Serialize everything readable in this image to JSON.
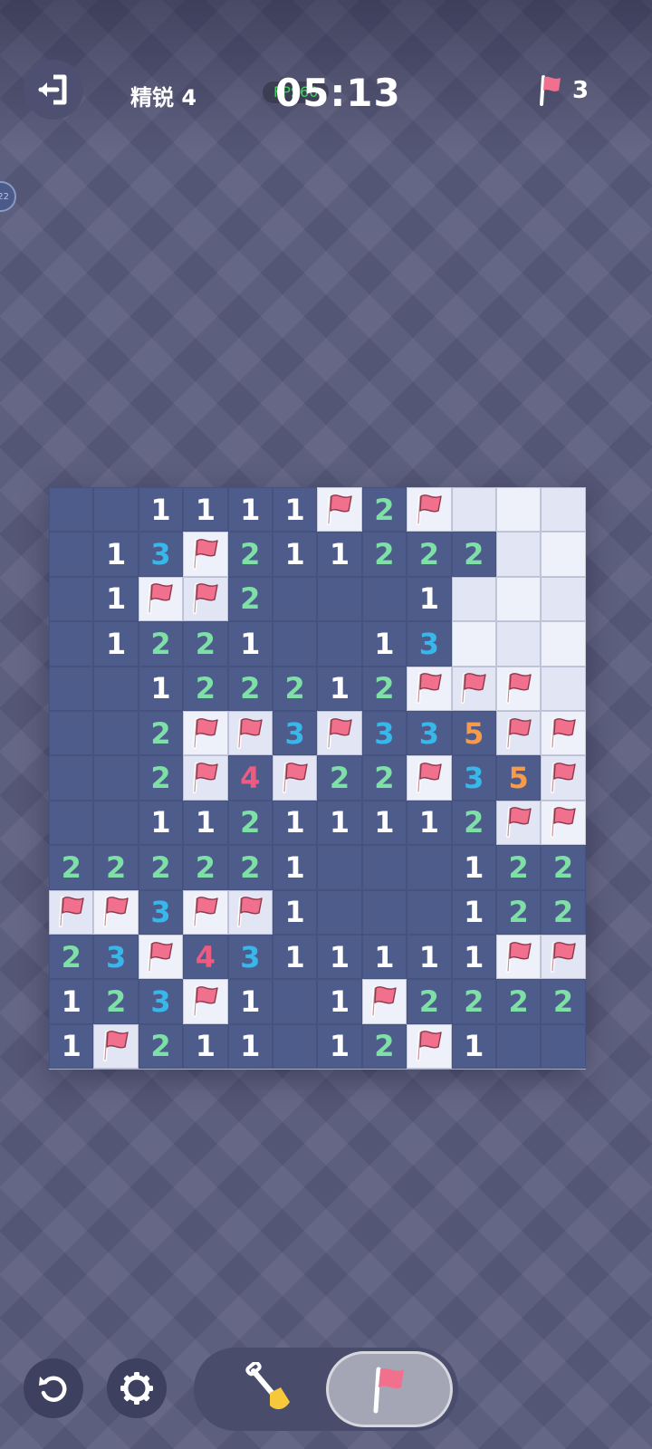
{
  "header": {
    "level_label": "精锐 4",
    "fps_label": "FPS60",
    "timer": "05:13",
    "flags_remaining": "3",
    "side_tab_label": "22"
  },
  "board": {
    "cols": 12,
    "rows_count": 13,
    "rows": [
      [
        "R",
        "R",
        "1",
        "1",
        "1",
        "1",
        "F",
        "2",
        "F",
        "C",
        "C",
        "C"
      ],
      [
        "R",
        "1",
        "3",
        "F",
        "2",
        "1",
        "1",
        "2",
        "2",
        "2",
        "C",
        "C"
      ],
      [
        "R",
        "1",
        "F",
        "F",
        "2",
        "R",
        "R",
        "R",
        "1",
        "C",
        "C",
        "C"
      ],
      [
        "R",
        "1",
        "2",
        "2",
        "1",
        "R",
        "R",
        "1",
        "3",
        "C",
        "C",
        "C"
      ],
      [
        "R",
        "R",
        "1",
        "2",
        "2",
        "2",
        "1",
        "2",
        "F",
        "F",
        "F",
        "C"
      ],
      [
        "R",
        "R",
        "2",
        "F",
        "F",
        "3",
        "F",
        "3",
        "3",
        "5",
        "F",
        "F"
      ],
      [
        "R",
        "R",
        "2",
        "F",
        "4",
        "F",
        "2",
        "2",
        "F",
        "3",
        "5",
        "F"
      ],
      [
        "R",
        "R",
        "1",
        "1",
        "2",
        "1",
        "1",
        "1",
        "1",
        "2",
        "F",
        "F"
      ],
      [
        "2",
        "2",
        "2",
        "2",
        "2",
        "1",
        "R",
        "R",
        "R",
        "1",
        "2",
        "2"
      ],
      [
        "F",
        "F",
        "3",
        "F",
        "F",
        "1",
        "R",
        "R",
        "R",
        "1",
        "2",
        "2"
      ],
      [
        "2",
        "3",
        "F",
        "4",
        "3",
        "1",
        "1",
        "1",
        "1",
        "1",
        "F",
        "F"
      ],
      [
        "1",
        "2",
        "3",
        "F",
        "1",
        "R",
        "1",
        "F",
        "2",
        "2",
        "2",
        "2"
      ],
      [
        "1",
        "F",
        "2",
        "1",
        "1",
        "R",
        "1",
        "2",
        "F",
        "1",
        "R",
        "R"
      ]
    ],
    "legend": {
      "R": "revealed-empty",
      "C": "covered",
      "F": "flagged"
    }
  },
  "colors": {
    "number_1": "#ffffff",
    "number_2": "#7ee0a6",
    "number_3": "#38b8ea",
    "number_4": "#ef5a80",
    "number_5": "#f79a4a",
    "flag": "#f0708e",
    "revealed_cell": "#4e5c8c",
    "covered_cell": "#eef0fa"
  },
  "toolbar": {
    "undo_icon": "undo-icon",
    "settings_icon": "gear-icon",
    "dig_icon": "shovel-icon",
    "flag_icon": "flag-icon",
    "active_tool": "flag"
  }
}
